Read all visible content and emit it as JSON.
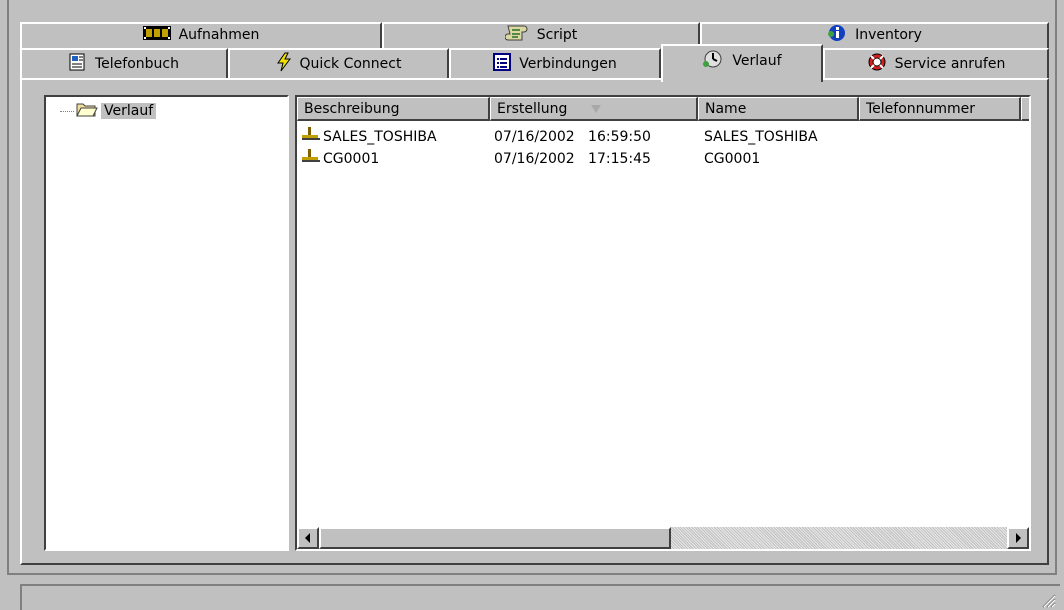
{
  "tabs_row1": [
    {
      "label": "Aufnahmen",
      "icon": "film-icon"
    },
    {
      "label": "Script",
      "icon": "script-scroll-icon"
    },
    {
      "label": "Inventory",
      "icon": "info-globe-icon"
    }
  ],
  "tabs_row2": [
    {
      "label": "Telefonbuch",
      "icon": "phonebook-icon"
    },
    {
      "label": "Quick Connect",
      "icon": "lightning-icon"
    },
    {
      "label": "Verbindungen",
      "icon": "list-window-icon"
    },
    {
      "label": "Verlauf",
      "icon": "history-clock-icon",
      "active": true
    },
    {
      "label": "Service anrufen",
      "icon": "lifebuoy-icon"
    }
  ],
  "tree": {
    "root_label": "Verlauf"
  },
  "list": {
    "columns": [
      "Beschreibung",
      "Erstellung",
      "Name",
      "Telefonnummer"
    ],
    "sorted_column": "Erstellung",
    "rows": [
      {
        "beschreibung": "SALES_TOSHIBA",
        "erstellung": "07/16/2002   16:59:50",
        "name": "SALES_TOSHIBA",
        "telefonnummer": ""
      },
      {
        "beschreibung": "CG0001",
        "erstellung": "07/16/2002   17:15:45",
        "name": "CG0001",
        "telefonnummer": ""
      }
    ]
  },
  "colors": {
    "face": "#c0c0c0",
    "highlight": "#ffffff",
    "shadow": "#808080",
    "dark_shadow": "#404040"
  }
}
